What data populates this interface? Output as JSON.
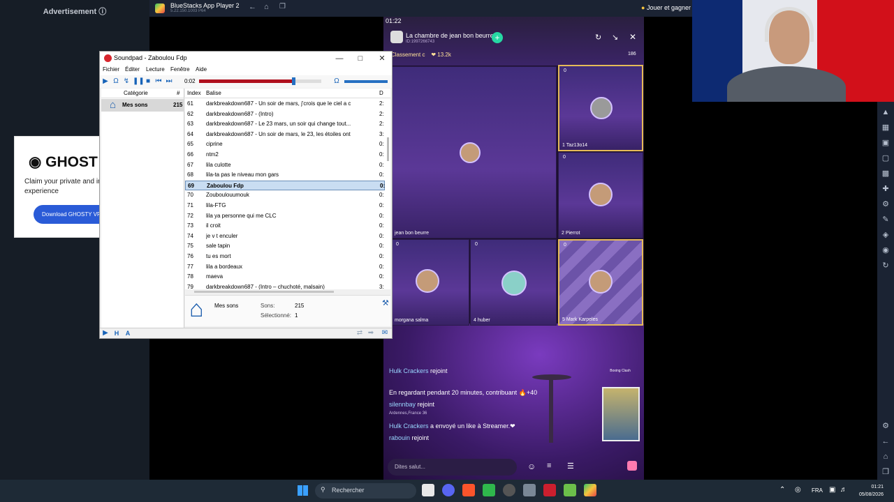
{
  "ad": {
    "label": "Advertisement ⓘ",
    "brand": "GHOST",
    "text": "Claim your private and internet experience",
    "button": "Download GHOSTY VPN"
  },
  "bluestacks": {
    "title": "BlueStacks App Player 2",
    "version": "5.22.150.1003 P64",
    "rewards": "Jouer et gagner"
  },
  "stream": {
    "time": "01:22",
    "room_title": "La chambre de jean bon beurre",
    "room_id": "ID:1997266743",
    "ranking": "Classement c",
    "likes": "13.2k",
    "viewers": "186",
    "tiles": [
      {
        "label": "jean bon beurre",
        "coins": ""
      },
      {
        "label": "1  Taz13o14",
        "coins": "0"
      },
      {
        "label": "2  Pierrot",
        "coins": "0"
      },
      {
        "label": "morgana salma",
        "coins": "0"
      },
      {
        "label": "4  huber",
        "coins": "0"
      },
      {
        "label": "5  Mark Karpeles",
        "coins": "0"
      }
    ],
    "chat": [
      {
        "user": "Hulk Crackers",
        "text": "rejoint"
      },
      {
        "user": "",
        "text": "En regardant pendant 20 minutes, contribuant 🔥+40"
      },
      {
        "user": "silennbay",
        "text": "rejoint"
      },
      {
        "user": "Ardennes,France",
        "text": "36"
      },
      {
        "user": "Hulk Crackers",
        "text": "a envoyé un like à Streamer.❤"
      },
      {
        "user": "rabouin",
        "text": "rejoint"
      }
    ],
    "say_hi": "Dites salut...",
    "boxing": "Boxing Clash"
  },
  "soundpad": {
    "title": "Soundpad - Zaboulou Fdp",
    "menu": [
      "Fichier",
      "Éditer",
      "Lecture",
      "Fenêtre",
      "Aide"
    ],
    "time": "0:02",
    "progress": 0.77,
    "category_header": "Catégorie",
    "count_header": "#",
    "category": {
      "name": "Mes sons",
      "count": "215"
    },
    "columns": {
      "index": "Index",
      "name": "Balise",
      "dur": "D"
    },
    "rows": [
      {
        "i": "61",
        "n": "darkbreakdown687 - Un soir de mars, j'crois que le ciel a c",
        "d": "2:"
      },
      {
        "i": "62",
        "n": "darkbreakdown687 - (Intro)",
        "d": "2:"
      },
      {
        "i": "63",
        "n": "darkbreakdown687 - Le 23 mars, un soir qui change tout...",
        "d": "2:"
      },
      {
        "i": "64",
        "n": "darkbreakdown687 - Un soir de mars, le 23, les étoiles ont",
        "d": "3:"
      },
      {
        "i": "65",
        "n": "ciprine",
        "d": "0:"
      },
      {
        "i": "66",
        "n": "ntm2",
        "d": "0:"
      },
      {
        "i": "67",
        "n": "lila culotte",
        "d": "0:"
      },
      {
        "i": "68",
        "n": "lila-ta pas le niveau mon gars",
        "d": "0:"
      },
      {
        "i": "69",
        "n": "Zaboulou Fdp",
        "d": "0:"
      },
      {
        "i": "70",
        "n": "Zouboulouumouk",
        "d": "0:"
      },
      {
        "i": "71",
        "n": "lila-FTG",
        "d": "0:"
      },
      {
        "i": "72",
        "n": "lila ya personne qui me CLC",
        "d": "0:"
      },
      {
        "i": "73",
        "n": "il croit",
        "d": "0:"
      },
      {
        "i": "74",
        "n": "je v t enculer",
        "d": "0:"
      },
      {
        "i": "75",
        "n": "sale tapin",
        "d": "0:"
      },
      {
        "i": "76",
        "n": "tu es mort",
        "d": "0:"
      },
      {
        "i": "77",
        "n": "lila a bordeaux",
        "d": "0:"
      },
      {
        "i": "78",
        "n": "maeva",
        "d": "0:"
      },
      {
        "i": "79",
        "n": "darkbreakdown687 - (Intro – chuchoté, malsain)",
        "d": "3:"
      }
    ],
    "footer": {
      "name": "Mes sons",
      "sounds_label": "Sons:",
      "sounds": "215",
      "selected_label": "Sélectionné:",
      "selected": "1"
    }
  },
  "taskbar": {
    "search": "Rechercher",
    "lang": "FRA",
    "time": "01:21",
    "date": "05/08/2026"
  }
}
